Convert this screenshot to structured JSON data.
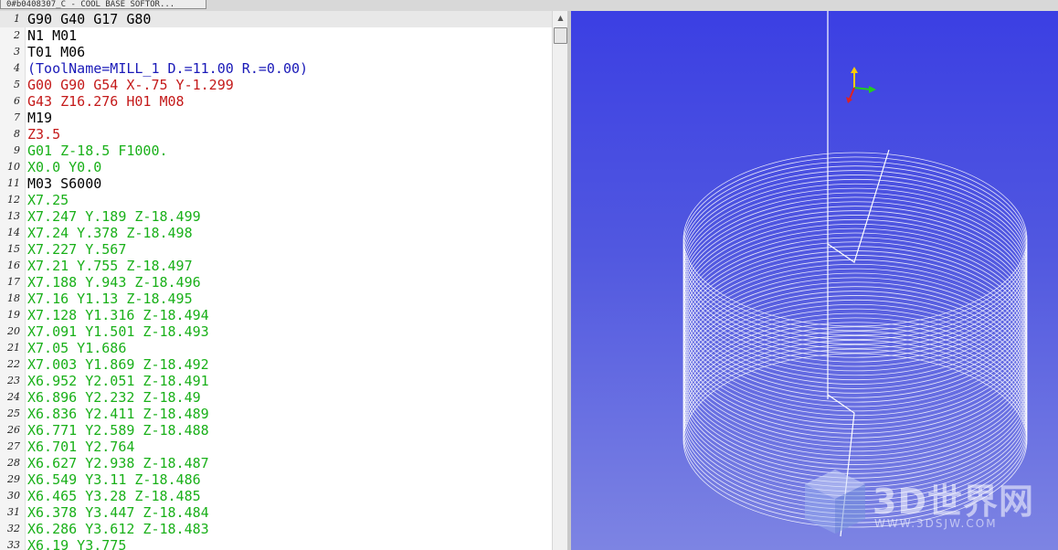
{
  "tab": {
    "title": "0#b0408307_C - COOL BASE SOFTOR..."
  },
  "editor": {
    "current_line": 1,
    "colors": {
      "default": "#000000",
      "comment": "#1a1ab8",
      "rapid": "#c41a1a",
      "feed": "#19b019"
    },
    "lines": [
      {
        "n": "1",
        "text": "G90 G40 G17 G80",
        "kind": "default"
      },
      {
        "n": "2",
        "text": "N1 M01",
        "kind": "default"
      },
      {
        "n": "3",
        "text": "T01 M06",
        "kind": "default"
      },
      {
        "n": "4",
        "text": "(ToolName=MILL_1 D.=11.00 R.=0.00)",
        "kind": "comment"
      },
      {
        "n": "5",
        "text": "G00 G90 G54 X-.75 Y-1.299",
        "kind": "rapid"
      },
      {
        "n": "6",
        "text": "G43 Z16.276 H01 M08",
        "kind": "rapid"
      },
      {
        "n": "7",
        "text": "M19",
        "kind": "default"
      },
      {
        "n": "8",
        "text": "Z3.5",
        "kind": "rapid"
      },
      {
        "n": "9",
        "text": "G01 Z-18.5 F1000.",
        "kind": "feed"
      },
      {
        "n": "10",
        "text": "X0.0 Y0.0",
        "kind": "feed"
      },
      {
        "n": "11",
        "text": "M03 S6000",
        "kind": "default"
      },
      {
        "n": "12",
        "text": "X7.25",
        "kind": "feed"
      },
      {
        "n": "13",
        "text": "X7.247 Y.189 Z-18.499",
        "kind": "feed"
      },
      {
        "n": "14",
        "text": "X7.24 Y.378 Z-18.498",
        "kind": "feed"
      },
      {
        "n": "15",
        "text": "X7.227 Y.567",
        "kind": "feed"
      },
      {
        "n": "16",
        "text": "X7.21 Y.755 Z-18.497",
        "kind": "feed"
      },
      {
        "n": "17",
        "text": "X7.188 Y.943 Z-18.496",
        "kind": "feed"
      },
      {
        "n": "18",
        "text": "X7.16 Y1.13 Z-18.495",
        "kind": "feed"
      },
      {
        "n": "19",
        "text": "X7.128 Y1.316 Z-18.494",
        "kind": "feed"
      },
      {
        "n": "20",
        "text": "X7.091 Y1.501 Z-18.493",
        "kind": "feed"
      },
      {
        "n": "21",
        "text": "X7.05 Y1.686",
        "kind": "feed"
      },
      {
        "n": "22",
        "text": "X7.003 Y1.869 Z-18.492",
        "kind": "feed"
      },
      {
        "n": "23",
        "text": "X6.952 Y2.051 Z-18.491",
        "kind": "feed"
      },
      {
        "n": "24",
        "text": "X6.896 Y2.232 Z-18.49",
        "kind": "feed"
      },
      {
        "n": "25",
        "text": "X6.836 Y2.411 Z-18.489",
        "kind": "feed"
      },
      {
        "n": "26",
        "text": "X6.771 Y2.589 Z-18.488",
        "kind": "feed"
      },
      {
        "n": "27",
        "text": "X6.701 Y2.764",
        "kind": "feed"
      },
      {
        "n": "28",
        "text": "X6.627 Y2.938 Z-18.487",
        "kind": "feed"
      },
      {
        "n": "29",
        "text": "X6.549 Y3.11 Z-18.486",
        "kind": "feed"
      },
      {
        "n": "30",
        "text": "X6.465 Y3.28 Z-18.485",
        "kind": "feed"
      },
      {
        "n": "31",
        "text": "X6.378 Y3.447 Z-18.484",
        "kind": "feed"
      },
      {
        "n": "32",
        "text": "X6.286 Y3.612 Z-18.483",
        "kind": "feed"
      },
      {
        "n": "33",
        "text": "X6.19 Y3.775",
        "kind": "feed"
      }
    ]
  },
  "viewport": {
    "background_top": "#3b3fe3",
    "background_bottom": "#7d84e3",
    "toolpath_color": "#ffffff",
    "axis_colors": {
      "x": "#22cc22",
      "y": "#ffcc00",
      "z": "#dd2222"
    },
    "scrollbar_arrow": "▲"
  },
  "watermark": {
    "title": "3D世界网",
    "url": "WWW.3DSJW.COM"
  }
}
